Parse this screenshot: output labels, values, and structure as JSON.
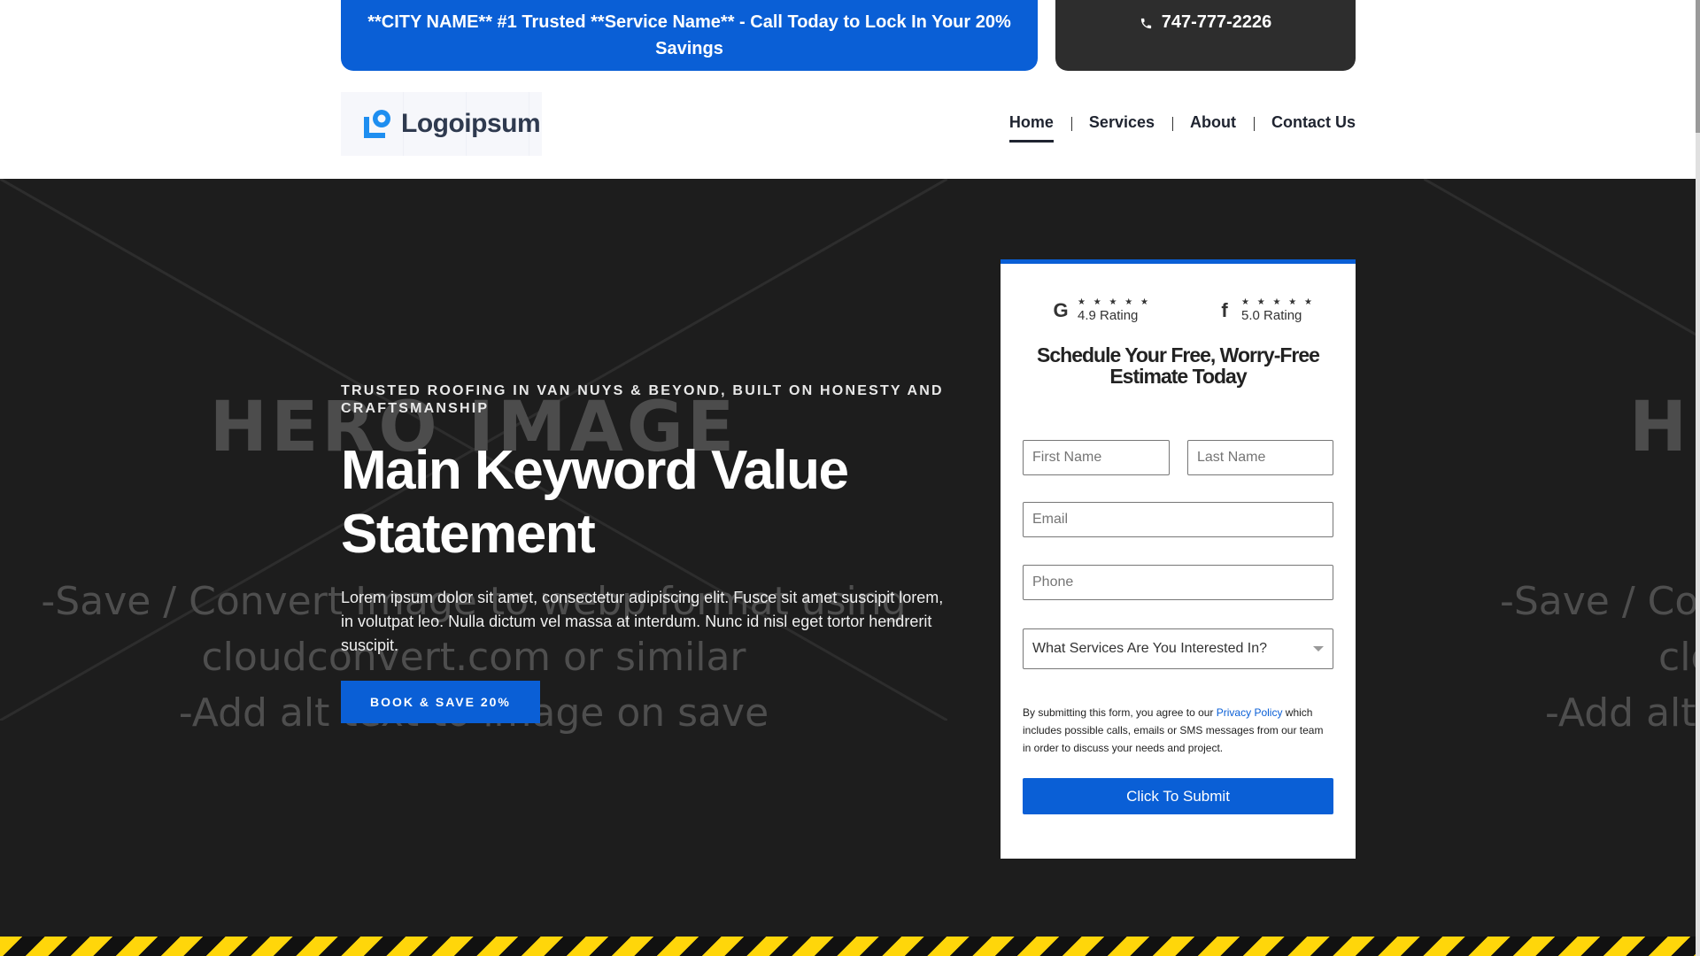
{
  "topbar": {
    "promo": "**CITY NAME** #1 Trusted **Service Name** - Call Today to Lock In Your 20% Savings",
    "phone": "747-777-2226",
    "colors": {
      "promo": "#0a5fd6",
      "phone": "#2d2d2d"
    }
  },
  "header": {
    "logo_text": "Logoipsum",
    "nav": [
      "Home",
      "Services",
      "About",
      "Contact Us"
    ],
    "active": "Home"
  },
  "hero": {
    "placeholder": {
      "title": "HERO IMAGE",
      "line1": "-Save / Convert Image to webp format using",
      "line2": "cloudconvert.com or similar",
      "line3": "-Add alt text to image on save",
      "right_line1": "-Save / Co",
      "right_line2": "clo",
      "right_line3": "-Add alt"
    },
    "eyebrow": "TRUSTED ROOFING IN VAN NUYS & BEYOND, BUILT ON HONESTY AND CRAFTSMANSHIP",
    "heading": "Main Keyword Value Statement",
    "body": "Lorem ipsum dolor sit amet, consectetur adipiscing elit. Fusce sit amet suscipit lorem, in volutpat leo. Nulla dictum vel massa at interdum. Nunc id nisl eget tortor hendrerit suscipit.",
    "cta": "BOOK & SAVE 20%"
  },
  "form": {
    "ratings": [
      {
        "brand": "G",
        "icon": "google-icon",
        "stars": "★ ★ ★ ★ ★",
        "text": "4.9 Rating"
      },
      {
        "brand": "f",
        "icon": "facebook-icon",
        "stars": "★ ★ ★ ★ ★",
        "text": "5.0 Rating"
      }
    ],
    "title": "Schedule Your Free, Worry-Free Estimate Today",
    "first_name": "First Name",
    "last_name": "Last Name",
    "email": "Email",
    "phone": "Phone",
    "service_select": "What Services Are You Interested In?",
    "consent_before": "By submitting this form, you agree to our ",
    "consent_link": "Privacy Policy",
    "consent_after": " which includes possible calls, emails or SMS messages from our team in order to discuss your needs and project.",
    "submit": "Click To Submit",
    "accent": "#0a5fd6"
  }
}
